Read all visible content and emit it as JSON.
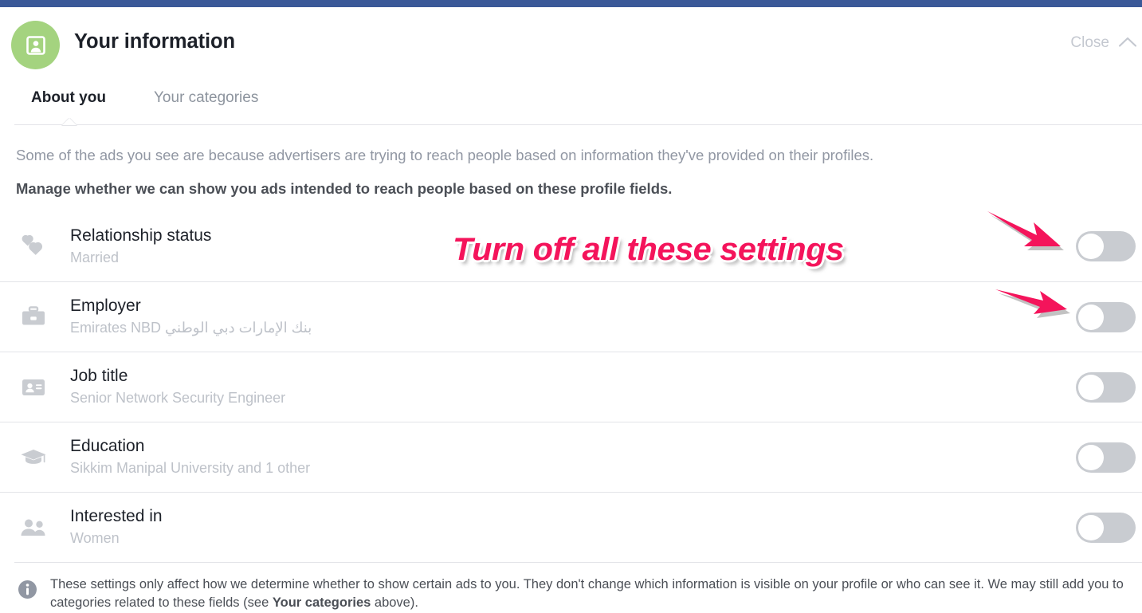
{
  "header": {
    "title": "Your information",
    "avatar_icon": "profile-card-icon",
    "avatar_color": "#a4d37f",
    "close_label": "Close",
    "close_icon": "chevron-up-icon"
  },
  "topbar": {
    "color": "#3b5998"
  },
  "tabs": [
    {
      "label": "About you",
      "active": true
    },
    {
      "label": "Your categories",
      "active": false
    }
  ],
  "intro": {
    "paragraph": "Some of the ads you see are because advertisers are trying to reach people based on information they've provided on their profiles.",
    "manage_heading": "Manage whether we can show you ads intended to reach people based on these profile fields."
  },
  "settings": [
    {
      "icon": "hearts-icon",
      "label": "Relationship status",
      "value": "Married",
      "rtl": false,
      "toggle_state": "off"
    },
    {
      "icon": "briefcase-icon",
      "label": "Employer",
      "value": "بنك الإمارات دبي الوطني Emirates NBD",
      "rtl": true,
      "toggle_state": "off"
    },
    {
      "icon": "id-card-icon",
      "label": "Job title",
      "value": "Senior Network Security Engineer",
      "rtl": false,
      "toggle_state": "off"
    },
    {
      "icon": "graduation-cap-icon",
      "label": "Education",
      "value": "Sikkim Manipal University and 1 other",
      "rtl": false,
      "toggle_state": "off"
    },
    {
      "icon": "people-icon",
      "label": "Interested in",
      "value": "Women",
      "rtl": false,
      "toggle_state": "off"
    }
  ],
  "footer": {
    "icon": "info-icon",
    "text_part1": "These settings only affect how we determine whether to show certain ads to you. They don't change which information is visible on your profile or who can see it. We may still add you to categories related to these fields (see ",
    "text_link": "Your categories",
    "text_part2": " above)."
  },
  "annotations": {
    "callout_text": "Turn off all these settings",
    "callout_color": "#f4145b",
    "arrows": [
      {
        "name": "arrow-to-relationship-toggle"
      },
      {
        "name": "arrow-to-employer-toggle"
      }
    ]
  }
}
